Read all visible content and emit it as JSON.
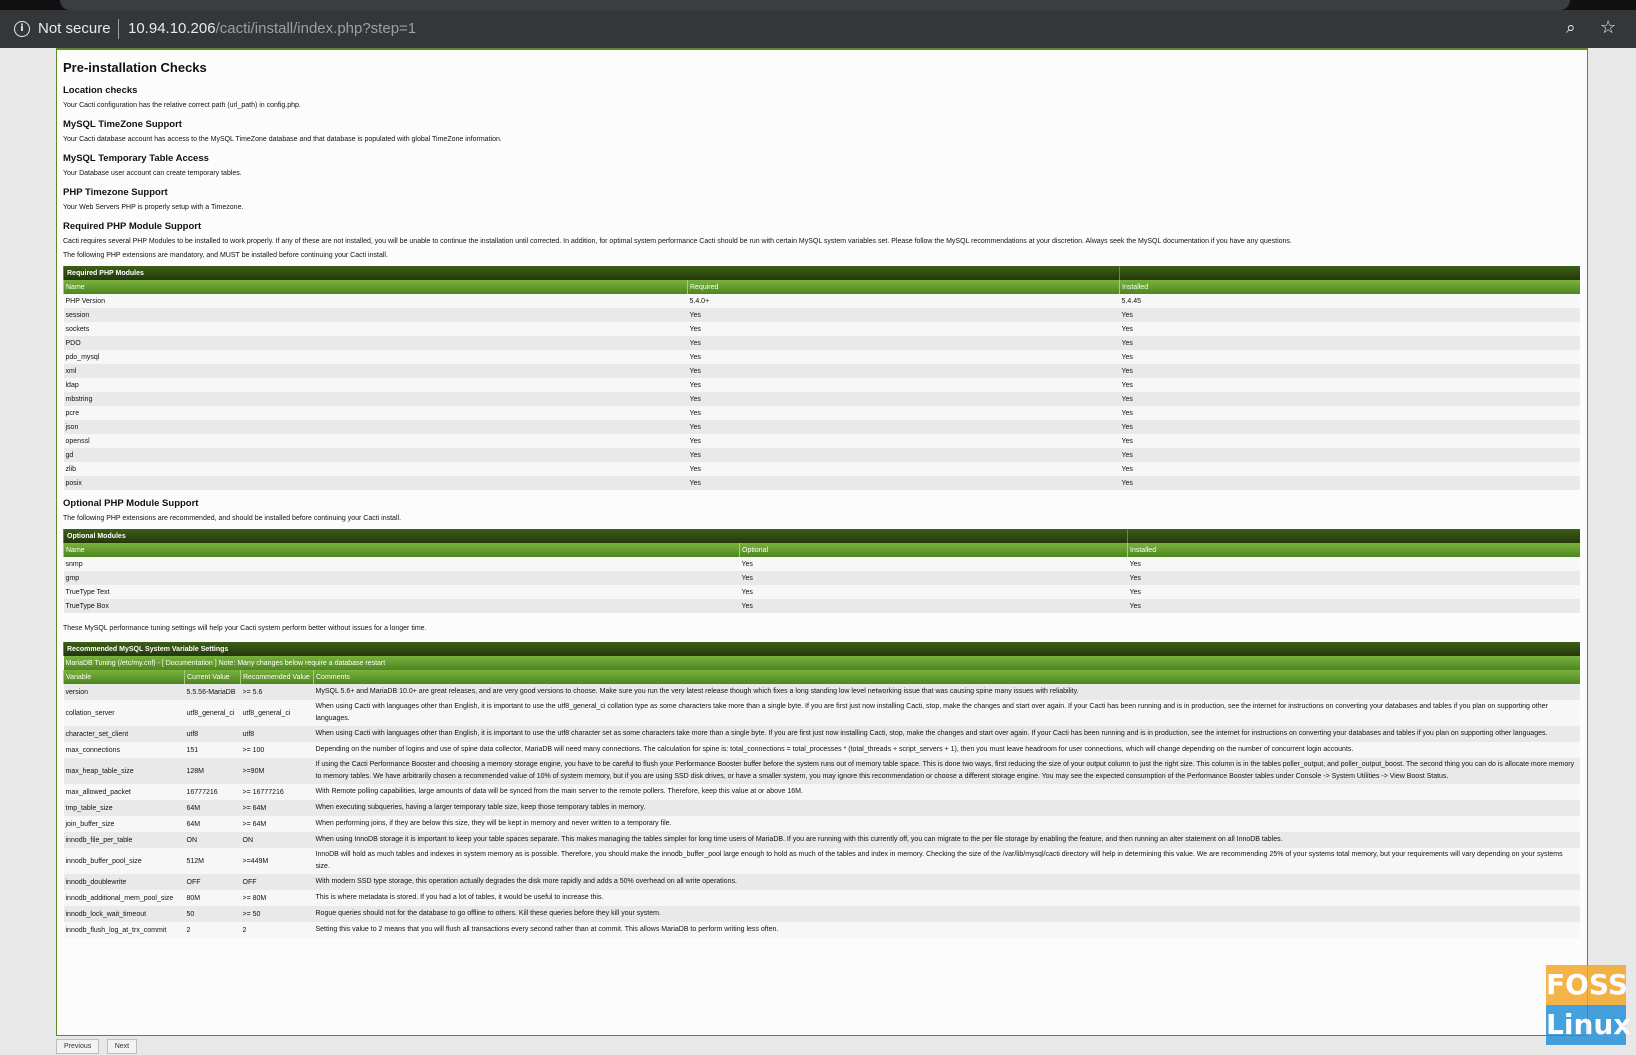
{
  "browser": {
    "security_label": "Not secure",
    "url_host": "10.94.10.206",
    "url_path": "/cacti/install/index.php?step=1"
  },
  "page": {
    "title": "Pre-installation Checks",
    "sections": {
      "location": {
        "heading": "Location checks",
        "text": "Your Cacti configuration has the relative correct path (url_path) in config.php."
      },
      "timezone_mysql": {
        "heading": "MySQL TimeZone Support",
        "text": "Your Cacti database account has access to the MySQL TimeZone database and that database is populated with global TimeZone information."
      },
      "temp_table": {
        "heading": "MySQL Temporary Table Access",
        "text": "Your Database user account can create temporary tables."
      },
      "php_timezone": {
        "heading": "PHP Timezone Support",
        "text": "Your Web Servers PHP is properly setup with a Timezone."
      },
      "required_modules": {
        "heading": "Required PHP Module Support",
        "text1": "Cacti requires several PHP Modules to be installed to work properly. If any of these are not installed, you will be unable to continue the installation until corrected. In addition, for optimal system performance Cacti should be run with certain MySQL system variables set. Please follow the MySQL recommendations at your discretion. Always seek the MySQL documentation if you have any questions.",
        "text2": "The following PHP extensions are mandatory, and MUST be installed before continuing your Cacti install."
      },
      "optional_modules": {
        "heading": "Optional PHP Module Support",
        "text": "The following PHP extensions are recommended, and should be installed before continuing your Cacti install."
      },
      "mysql_tuning": {
        "text": "These MySQL performance tuning settings will help your Cacti system perform better without issues for a longer time."
      }
    }
  },
  "required_table": {
    "caption": "Required PHP Modules",
    "headers": [
      "Name",
      "Required",
      "Installed"
    ],
    "rows": [
      [
        "PHP Version",
        "5.4.0+",
        "5.4.45"
      ],
      [
        "session",
        "Yes",
        "Yes"
      ],
      [
        "sockets",
        "Yes",
        "Yes"
      ],
      [
        "PDO",
        "Yes",
        "Yes"
      ],
      [
        "pdo_mysql",
        "Yes",
        "Yes"
      ],
      [
        "xml",
        "Yes",
        "Yes"
      ],
      [
        "ldap",
        "Yes",
        "Yes"
      ],
      [
        "mbstring",
        "Yes",
        "Yes"
      ],
      [
        "pcre",
        "Yes",
        "Yes"
      ],
      [
        "json",
        "Yes",
        "Yes"
      ],
      [
        "openssl",
        "Yes",
        "Yes"
      ],
      [
        "gd",
        "Yes",
        "Yes"
      ],
      [
        "zlib",
        "Yes",
        "Yes"
      ],
      [
        "posix",
        "Yes",
        "Yes"
      ]
    ]
  },
  "optional_table": {
    "caption": "Optional Modules",
    "headers": [
      "Name",
      "Optional",
      "Installed"
    ],
    "rows": [
      [
        "snmp",
        "Yes",
        "Yes"
      ],
      [
        "gmp",
        "Yes",
        "Yes"
      ],
      [
        "TrueType Text",
        "Yes",
        "Yes"
      ],
      [
        "TrueType Box",
        "Yes",
        "Yes"
      ]
    ]
  },
  "mysql_table": {
    "caption": "Recommended MySQL System Variable Settings",
    "subcaption": "MariaDB Tuning (/etc/my.cnf) - [ Documentation ] Note: Many changes below require a database restart",
    "headers": [
      "Variable",
      "Current Value",
      "Recommended Value",
      "Comments"
    ],
    "rows": [
      [
        "version",
        "5.5.56-MariaDB",
        ">= 5.6",
        "MySQL 5.6+ and MariaDB 10.0+ are great releases, and are very good versions to choose. Make sure you run the very latest release though which fixes a long standing low level networking issue that was causing spine many issues with reliability."
      ],
      [
        "collation_server",
        "utf8_general_ci",
        "utf8_general_ci",
        "When using Cacti with languages other than English, it is important to use the utf8_general_ci collation type as some characters take more than a single byte. If you are first just now installing Cacti, stop, make the changes and start over again. If your Cacti has been running and is in production, see the internet for instructions on converting your databases and tables if you plan on supporting other languages."
      ],
      [
        "character_set_client",
        "utf8",
        "utf8",
        "When using Cacti with languages other than English, it is important to use the utf8 character set as some characters take more than a single byte. If you are first just now installing Cacti, stop, make the changes and start over again. If your Cacti has been running and is in production, see the internet for instructions on converting your databases and tables if you plan on supporting other languages."
      ],
      [
        "max_connections",
        "151",
        ">= 100",
        "Depending on the number of logins and use of spine data collector, MariaDB will need many connections. The calculation for spine is: total_connections = total_processes * (total_threads + script_servers + 1), then you must leave headroom for user connections, which will change depending on the number of concurrent login accounts."
      ],
      [
        "max_heap_table_size",
        "128M",
        ">=90M",
        "If using the Cacti Performance Booster and choosing a memory storage engine, you have to be careful to flush your Performance Booster buffer before the system runs out of memory table space. This is done two ways, first reducing the size of your output column to just the right size. This column is in the tables poller_output, and poller_output_boost. The second thing you can do is allocate more memory to memory tables. We have arbitrarily chosen a recommended value of 10% of system memory, but if you are using SSD disk drives, or have a smaller system, you may ignore this recommendation or choose a different storage engine. You may see the expected consumption of the Performance Booster tables under Console -> System Utilities -> View Boost Status."
      ],
      [
        "max_allowed_packet",
        "16777216",
        ">= 16777216",
        "With Remote polling capabilities, large amounts of data will be synced from the main server to the remote pollers. Therefore, keep this value at or above 16M."
      ],
      [
        "tmp_table_size",
        "64M",
        ">= 64M",
        "When executing subqueries, having a larger temporary table size, keep those temporary tables in memory."
      ],
      [
        "join_buffer_size",
        "64M",
        ">= 64M",
        "When performing joins, if they are below this size, they will be kept in memory and never written to a temporary file."
      ],
      [
        "innodb_file_per_table",
        "ON",
        "ON",
        "When using InnoDB storage it is important to keep your table spaces separate. This makes managing the tables simpler for long time users of MariaDB. If you are running with this currently off, you can migrate to the per file storage by enabling the feature, and then running an alter statement on all InnoDB tables."
      ],
      [
        "innodb_buffer_pool_size",
        "512M",
        ">=449M",
        "InnoDB will hold as much tables and indexes in system memory as is possible. Therefore, you should make the innodb_buffer_pool large enough to hold as much of the tables and index in memory. Checking the size of the /var/lib/mysql/cacti directory will help in determining this value. We are recommending 25% of your systems total memory, but your requirements will vary depending on your systems size."
      ],
      [
        "innodb_doublewrite",
        "OFF",
        "OFF",
        "With modern SSD type storage, this operation actually degrades the disk more rapidly and adds a 50% overhead on all write operations."
      ],
      [
        "innodb_additional_mem_pool_size",
        "80M",
        ">= 80M",
        "This is where metadata is stored. If you had a lot of tables, it would be useful to increase this."
      ],
      [
        "innodb_lock_wait_timeout",
        "50",
        ">= 50",
        "Rogue queries should not for the database to go offline to others. Kill these queries before they kill your system."
      ],
      [
        "innodb_flush_log_at_trx_commit",
        "2",
        "2",
        "Setting this value to 2 means that you will flush all transactions every second rather than at commit. This allows MariaDB to perform writing less often."
      ]
    ]
  },
  "buttons": {
    "previous": "Previous",
    "next": "Next"
  },
  "watermark": {
    "line1": "FOSS",
    "line2": "Linux"
  },
  "colors": {
    "caption_bg": "#2f4a11",
    "header_bg": "#5e9a2a",
    "ok_text": "#2a7a0a",
    "warn_text": "#d21e1e"
  }
}
